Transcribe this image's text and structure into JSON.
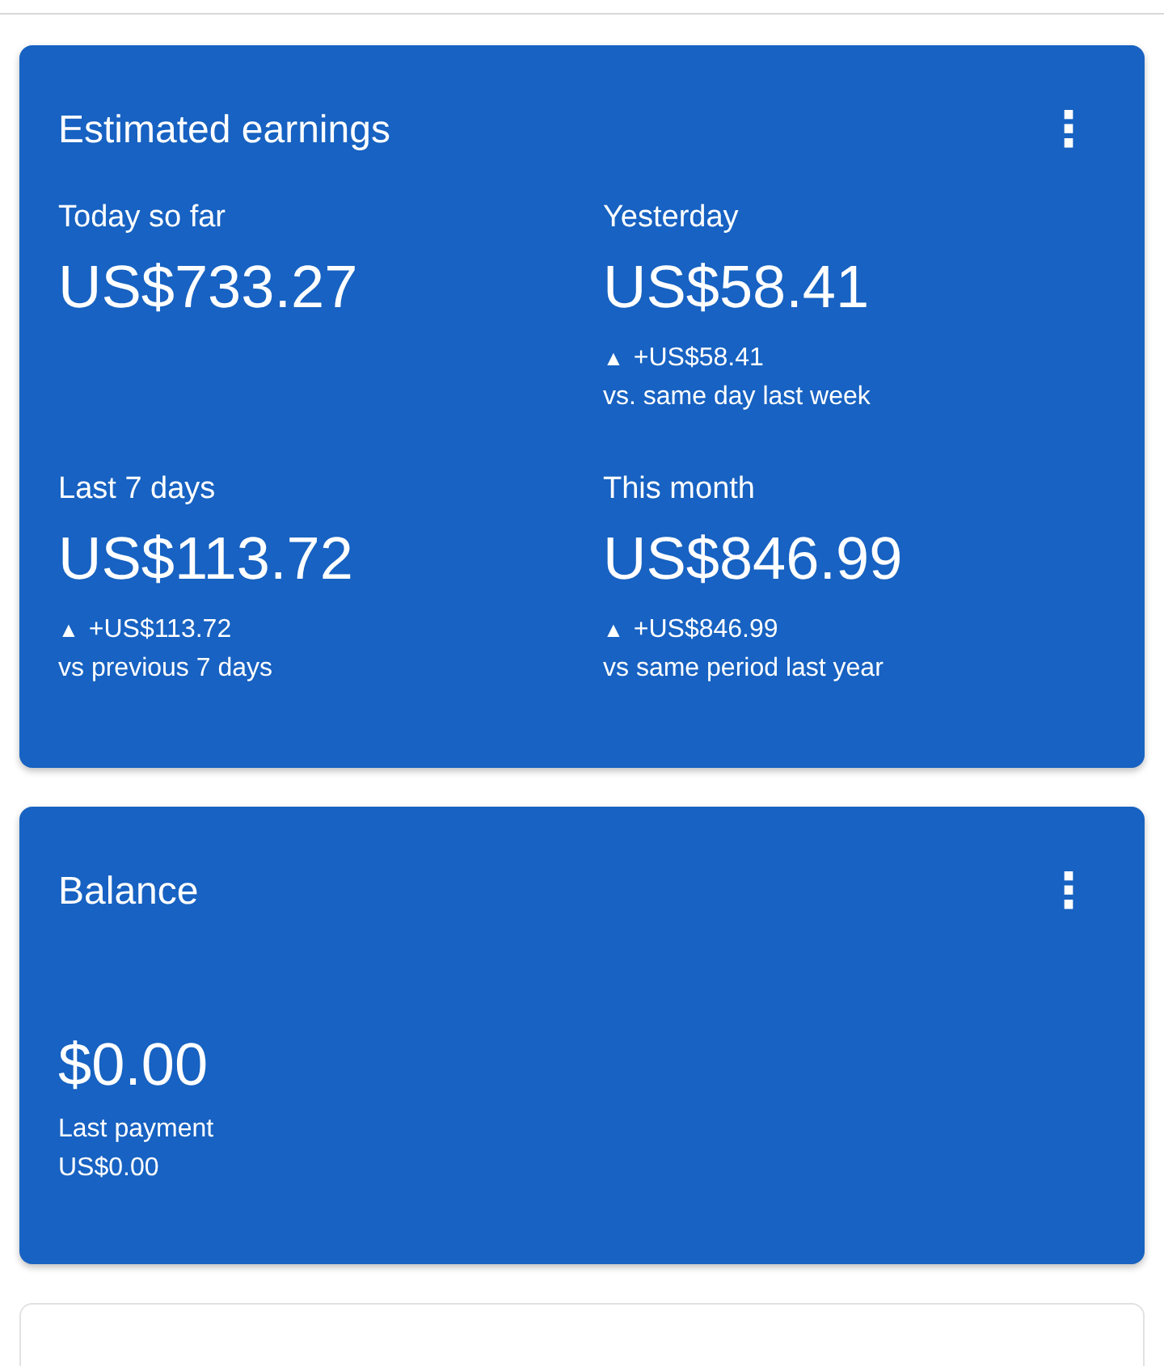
{
  "earnings": {
    "title": "Estimated earnings",
    "menu_icon": "⋮",
    "metrics": [
      {
        "label": "Today so far",
        "value": "US$733.27"
      },
      {
        "label": "Yesterday",
        "value": "US$58.41",
        "arrow": "▲",
        "change": "+US$58.41",
        "comparison": "vs. same day last week"
      },
      {
        "label": "Last 7 days",
        "value": "US$113.72",
        "arrow": "▲",
        "change": "+US$113.72",
        "comparison": "vs previous 7 days"
      },
      {
        "label": "This month",
        "value": "US$846.99",
        "arrow": "▲",
        "change": "+US$846.99",
        "comparison": "vs same period last year"
      }
    ]
  },
  "balance": {
    "title": "Balance",
    "menu_icon": "⋮",
    "value": "$0.00",
    "last_payment_label": "Last payment",
    "last_payment_value": "US$0.00"
  }
}
